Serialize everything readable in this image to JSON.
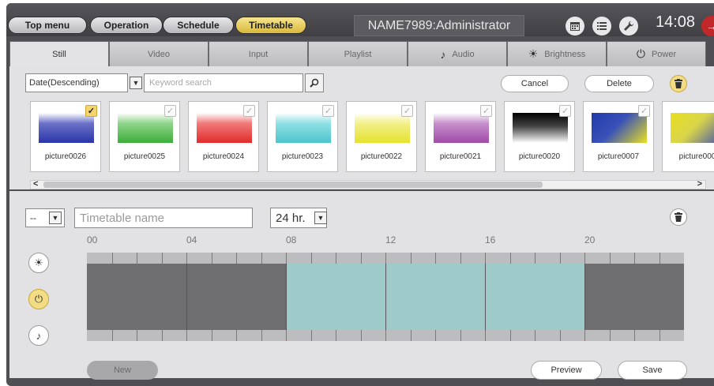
{
  "header": {
    "nav": [
      {
        "label": "Top menu",
        "active": false
      },
      {
        "label": "Operation",
        "active": false
      },
      {
        "label": "Schedule",
        "active": false
      },
      {
        "label": "Timetable",
        "active": true
      }
    ],
    "account": "NAME7989:Administrator",
    "icons": [
      "calendar-icon",
      "list-icon",
      "wrench-icon"
    ],
    "clock": "14:08",
    "exit_icon": "exit-icon"
  },
  "tabs": [
    {
      "label": "Still",
      "icon": "",
      "active": true
    },
    {
      "label": "Video",
      "icon": "",
      "active": false
    },
    {
      "label": "Input",
      "icon": "",
      "active": false
    },
    {
      "label": "Playlist",
      "icon": "",
      "active": false
    },
    {
      "label": "Audio",
      "icon": "♪",
      "active": false
    },
    {
      "label": "Brightness",
      "icon": "☀",
      "active": false
    },
    {
      "label": "Power",
      "icon": "⏻",
      "active": false
    }
  ],
  "content_bar": {
    "sort_value": "Date(Descending)",
    "search_placeholder": "Keyword search",
    "cancel_label": "Cancel",
    "delete_label": "Delete"
  },
  "thumbnails": [
    {
      "name": "picture0026",
      "checked": true,
      "swatch": "linear-gradient(#ffffff 0%, #6b72c8 35%, #2a34a8 100%)"
    },
    {
      "name": "picture0025",
      "checked": false,
      "swatch": "linear-gradient(#ffffff 0%, #8fd48a 35%, #3cae3a 100%)"
    },
    {
      "name": "picture0024",
      "checked": false,
      "swatch": "linear-gradient(#ffffff 0%, #f07a7a 35%, #e22a2a 100%)"
    },
    {
      "name": "picture0023",
      "checked": false,
      "swatch": "linear-gradient(#ffffff 0%, #8fe0e4 35%, #4cc4cc 100%)"
    },
    {
      "name": "picture0022",
      "checked": false,
      "swatch": "linear-gradient(#ffffff 0%, #f2f08a 35%, #e6e22e 100%)"
    },
    {
      "name": "picture0021",
      "checked": false,
      "swatch": "linear-gradient(#ffffff 0%, #c690cc 35%, #a04aa8 100%)"
    },
    {
      "name": "picture0020",
      "checked": false,
      "swatch": "linear-gradient(#000000 0%, #444444 45%, #ffffff 100%)"
    },
    {
      "name": "picture0007",
      "checked": false,
      "swatch": "linear-gradient(135deg, #1f3aa8 0%, #3a52b8 45%, #e8e020 100%)"
    },
    {
      "name": "picture000",
      "checked": false,
      "swatch": "linear-gradient(135deg, #e8e020 0%, #d8d44a 45%, #3a4ab8 100%)"
    }
  ],
  "timetable": {
    "day_value": "--",
    "name_placeholder": "Timetable name",
    "format_value": "24 hr.",
    "hour_labels": [
      "00",
      "04",
      "08",
      "12",
      "16",
      "20"
    ],
    "segments": [
      {
        "start": 0,
        "end": 8,
        "color": "#6e6e70"
      },
      {
        "start": 8,
        "end": 20,
        "color": "#9ecaca"
      },
      {
        "start": 20,
        "end": 24,
        "color": "#6e6e70"
      }
    ],
    "side_icons": [
      {
        "icon": "☀",
        "name": "brightness-icon",
        "active": false
      },
      {
        "icon": "⏻",
        "name": "power-icon",
        "active": true
      },
      {
        "icon": "♪",
        "name": "audio-icon",
        "active": false
      }
    ],
    "new_label": "New",
    "preview_label": "Preview",
    "save_label": "Save"
  }
}
